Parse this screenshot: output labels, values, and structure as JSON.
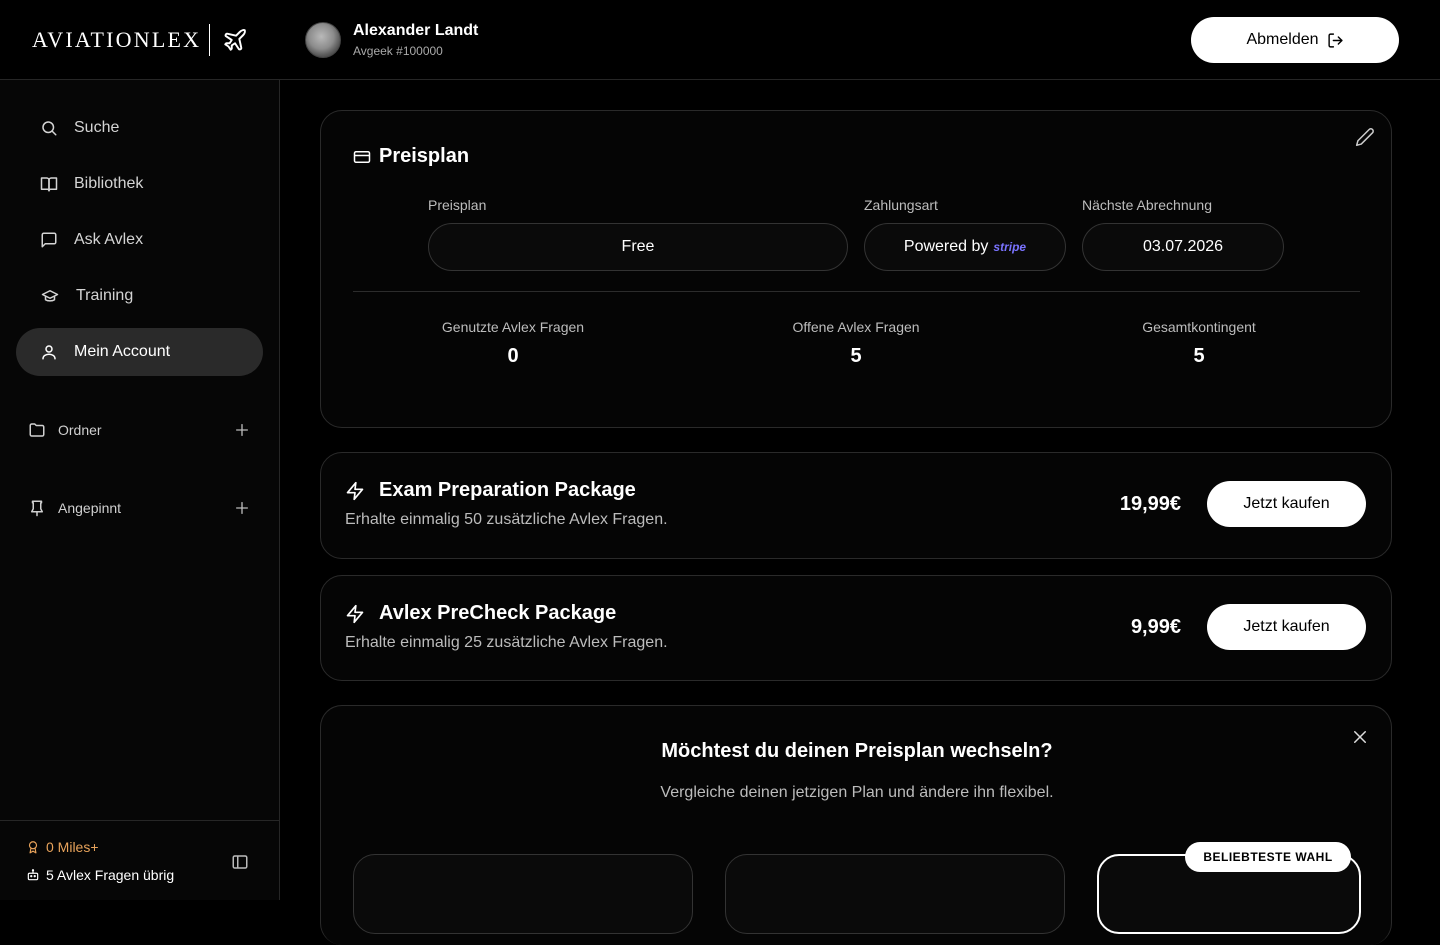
{
  "header": {
    "logo_text": "AVIATIONLEX",
    "user_name": "Alexander Landt",
    "user_sub": "Avgeek #100000",
    "logout_label": "Abmelden"
  },
  "sidebar": {
    "items": [
      {
        "label": "Suche",
        "icon": "search-icon"
      },
      {
        "label": "Bibliothek",
        "icon": "book-icon"
      },
      {
        "label": "Ask Avlex",
        "icon": "chat-icon"
      },
      {
        "label": "Training",
        "icon": "graduation-cap-icon"
      },
      {
        "label": "Mein Account",
        "icon": "user-icon",
        "active": true
      }
    ],
    "sections": [
      {
        "label": "Ordner",
        "icon": "folder-icon"
      },
      {
        "label": "Angepinnt",
        "icon": "pin-icon"
      }
    ],
    "footer": {
      "miles": "0 Miles+",
      "questions_left": "5 Avlex Fragen übrig"
    }
  },
  "plan": {
    "title": "Preisplan",
    "fields": [
      {
        "label": "Preisplan",
        "value": "Free"
      },
      {
        "label": "Zahlungsart",
        "value": "Powered by",
        "brand": "stripe"
      },
      {
        "label": "Nächste Abrechnung",
        "value": "03.07.2026"
      }
    ],
    "stats": [
      {
        "label": "Genutzte Avlex Fragen",
        "value": "0"
      },
      {
        "label": "Offene Avlex Fragen",
        "value": "5"
      },
      {
        "label": "Gesamtkontingent",
        "value": "5"
      }
    ]
  },
  "packages": [
    {
      "title": "Exam Preparation Package",
      "desc": "Erhalte einmalig 50 zusätzliche Avlex Fragen.",
      "price": "19,99€",
      "button": "Jetzt kaufen"
    },
    {
      "title": "Avlex PreCheck Package",
      "desc": "Erhalte einmalig 25 zusätzliche Avlex Fragen.",
      "price": "9,99€",
      "button": "Jetzt kaufen"
    }
  ],
  "switch": {
    "title": "Möchtest du deinen Preisplan wechseln?",
    "subtitle": "Vergleiche deinen jetzigen Plan und ändere ihn flexibel.",
    "badge": "BELIEBTESTE WAHL"
  },
  "colors": {
    "accent_miles": "#e8a35b",
    "stripe": "#7a73ff",
    "active_nav": "#2a2a2a"
  }
}
